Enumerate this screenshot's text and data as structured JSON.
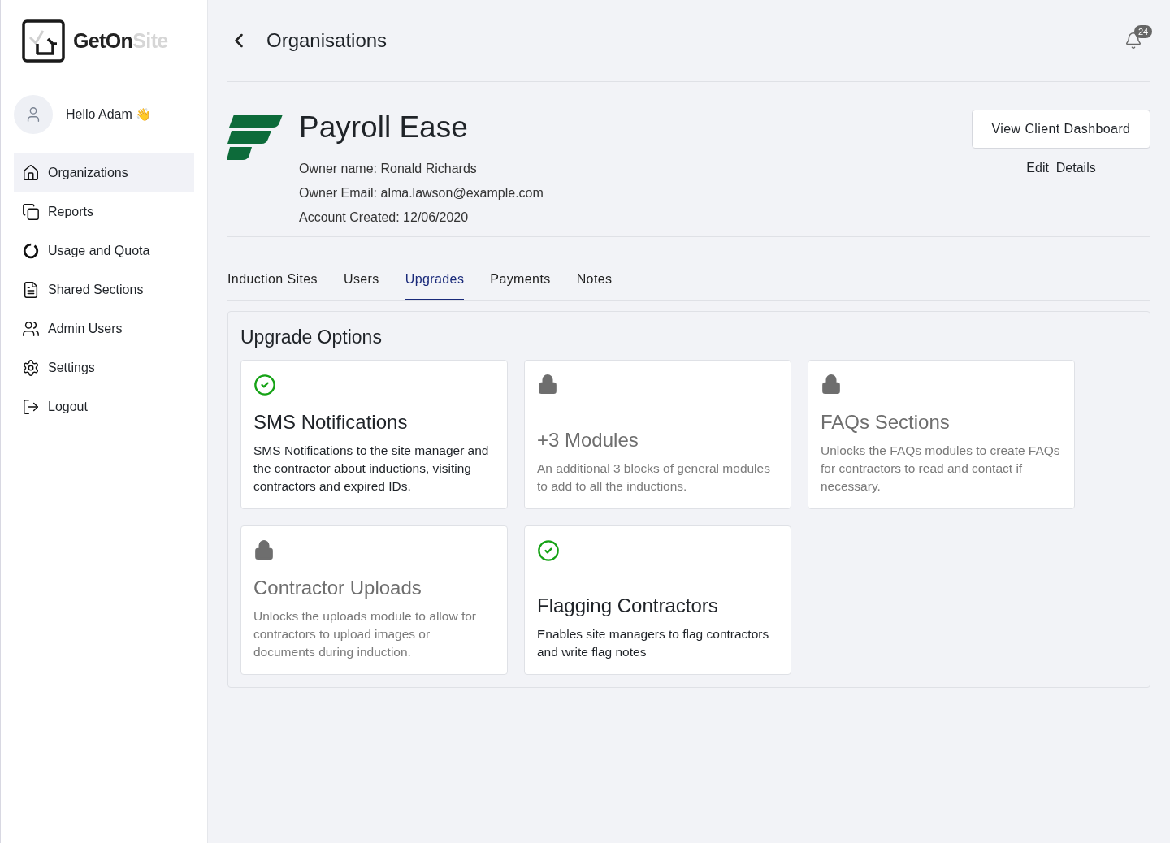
{
  "logo": {
    "primary": "GetOn",
    "secondary": "Site"
  },
  "user": {
    "greeting": "Hello Adam",
    "emoji": "👋"
  },
  "sidebar": {
    "items": [
      {
        "label": "Organizations",
        "selected": true
      },
      {
        "label": "Reports",
        "selected": false
      },
      {
        "label": "Usage and Quota",
        "selected": false
      },
      {
        "label": "Shared Sections",
        "selected": false
      },
      {
        "label": "Admin Users",
        "selected": false
      },
      {
        "label": "Settings",
        "selected": false
      },
      {
        "label": "Logout",
        "selected": false
      }
    ]
  },
  "header": {
    "title": "Organisations",
    "notifications": "24"
  },
  "organisation": {
    "name": "Payroll Ease",
    "details": [
      {
        "label": "Owner name:",
        "value": "Ronald Richards"
      },
      {
        "label": "Owner Email:",
        "value": "alma.lawson@example.com"
      },
      {
        "label": "Account Created:",
        "value": "12/06/2020"
      }
    ],
    "primary_action": "View Client Dashboard",
    "secondary_action": "Edit  Details"
  },
  "tabs": [
    {
      "label": "Induction Sites",
      "selected": false
    },
    {
      "label": "Users",
      "selected": false
    },
    {
      "label": "Upgrades",
      "selected": true
    },
    {
      "label": "Payments",
      "selected": false
    },
    {
      "label": "Notes",
      "selected": false
    }
  ],
  "upgrades": {
    "title": "Upgrade Options",
    "cards": [
      {
        "title": "SMS Notifications",
        "description": "SMS Notifications to the site manager and the contractor about inductions, visiting contractors and expired IDs.",
        "active": true
      },
      {
        "title": "+3 Modules",
        "description": "An additional 3 blocks of general modules to add to all the inductions.",
        "active": false
      },
      {
        "title": "FAQs Sections",
        "description": "Unlocks the FAQs modules to create FAQs for contractors to read and contact if necessary.",
        "active": false
      },
      {
        "title": "Contractor Uploads",
        "description": "Unlocks the uploads module to allow for contractors to upload images or documents during induction.",
        "active": false
      },
      {
        "title": "Flagging Contractors",
        "description": "Enables site managers to flag contractors and write flag notes",
        "active": true
      }
    ]
  }
}
